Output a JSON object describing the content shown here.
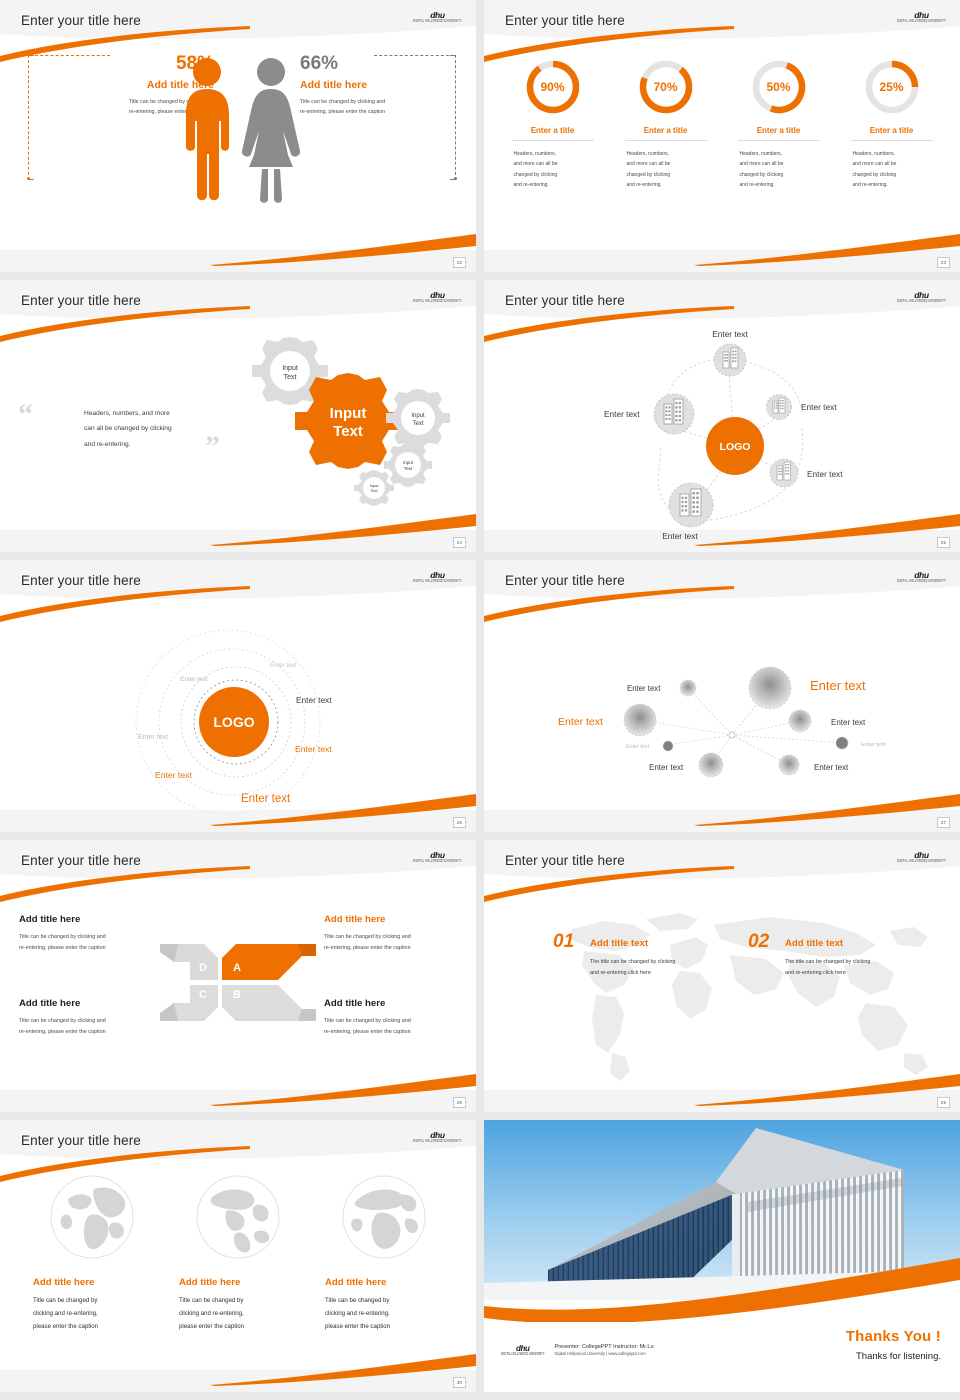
{
  "brand": {
    "accent": "#EE7000",
    "grey": "#8c8c8c",
    "logo_main": "dhu",
    "logo_sub": "DIGITAL HOLLYWOOD UNIVERSITY"
  },
  "common": {
    "title": "Enter your title here"
  },
  "slides": [
    {
      "page": "22",
      "title": "Enter your title here",
      "left": {
        "percent": "58%",
        "heading": "Add title here",
        "caption_l1": "Title can be changed by clicking and",
        "caption_l2": "re-entering, please enter the caption"
      },
      "right": {
        "percent": "66%",
        "heading": "Add title here",
        "caption_l1": "Title can be changed by clicking and",
        "caption_l2": "re-entering, please enter the caption"
      },
      "icons": [
        "male-figure-icon",
        "female-figure-icon"
      ]
    },
    {
      "page": "23",
      "title": "Enter your title here",
      "rings": [
        {
          "value": "90%",
          "pct": 90,
          "title": "Enter a title",
          "body_l1": "Headers, numbers,",
          "body_l2": "and more can all be",
          "body_l3": "changed by clicking",
          "body_l4": "and re-entering."
        },
        {
          "value": "70%",
          "pct": 70,
          "title": "Enter a title",
          "body_l1": "Headers, numbers,",
          "body_l2": "and more can all be",
          "body_l3": "changed by clicking",
          "body_l4": "and re-entering."
        },
        {
          "value": "50%",
          "pct": 50,
          "title": "Enter a title",
          "body_l1": "Headers, numbers,",
          "body_l2": "and more can all be",
          "body_l3": "changed by clicking",
          "body_l4": "and re-entering."
        },
        {
          "value": "25%",
          "pct": 25,
          "title": "Enter a title",
          "body_l1": "Headers, numbers,",
          "body_l2": "and more can all be",
          "body_l3": "changed by clicking",
          "body_l4": "and re-entering."
        }
      ]
    },
    {
      "page": "24",
      "title": "Enter your title here",
      "quote_l1": "Headers, numbers, and more",
      "quote_l2": "can all be changed by clicking",
      "quote_l3": "and re-entering.",
      "gears": [
        {
          "label_l1": "Input",
          "label_l2": "Text",
          "color": "grey"
        },
        {
          "label_l1": "Input",
          "label_l2": "Text",
          "color": "orange"
        },
        {
          "label_l1": "Input",
          "label_l2": "Text",
          "color": "grey"
        },
        {
          "label_l1": "Input",
          "label_l2": "Text",
          "color": "grey"
        },
        {
          "label_l1": "Input",
          "label_l2": "Text",
          "color": "grey"
        }
      ]
    },
    {
      "page": "25",
      "title": "Enter your title here",
      "hub_label": "LOGO",
      "nodes": [
        {
          "label": "Enter text"
        },
        {
          "label": "Enter text"
        },
        {
          "label": "Enter text"
        },
        {
          "label": "Enter text"
        },
        {
          "label": "Enter text"
        }
      ]
    },
    {
      "page": "26",
      "title": "Enter your title here",
      "hub_label": "LOGO",
      "orbit_labels": [
        "Enter text",
        "Enter text",
        "Enter text",
        "Enter text",
        "Enter text",
        "Enter text"
      ]
    },
    {
      "page": "27",
      "title": "Enter your title here",
      "nodes": [
        {
          "label": "Enter text"
        },
        {
          "label": "Enter text"
        },
        {
          "label": "Enter text"
        },
        {
          "label": "Enter text"
        },
        {
          "label": "Enter text"
        },
        {
          "label": "Enter text"
        },
        {
          "label": "Enter text"
        },
        {
          "label": "Enter text"
        }
      ]
    },
    {
      "page": "28",
      "title": "Enter your title here",
      "quads": [
        {
          "heading": "Add title here",
          "accent": false,
          "p1": "Title can be changed by clicking and",
          "p2": "re-entering, please enter the caption"
        },
        {
          "heading": "Add title here",
          "accent": true,
          "p1": "Title can be changed by clicking and",
          "p2": "re-entering, please enter the caption"
        },
        {
          "heading": "Add title here",
          "accent": false,
          "p1": "Title can be changed by clicking and",
          "p2": "re-entering, please enter the caption"
        },
        {
          "heading": "Add title here",
          "accent": false,
          "p1": "Title can be changed by clicking and",
          "p2": "re-entering, please enter the caption"
        }
      ],
      "letters": [
        "A",
        "B",
        "C",
        "D"
      ]
    },
    {
      "page": "29",
      "title": "Enter your title here",
      "items": [
        {
          "num": "01",
          "heading": "Add title text",
          "p1": "The title can be changed by clicking",
          "p2": "and re-entering click here"
        },
        {
          "num": "02",
          "heading": "Add title text",
          "p1": "The title can be changed by clicking",
          "p2": "and re-entering click here"
        }
      ]
    },
    {
      "page": "30",
      "title": "Enter your title here",
      "cards": [
        {
          "heading": "Add title here",
          "p1": "Title can be changed by",
          "p2": "clicking and re-entering,",
          "p3": "please enter the caption"
        },
        {
          "heading": "Add title here",
          "p1": "Title can be changed by",
          "p2": "clicking and re-entering,",
          "p3": "please enter the caption"
        },
        {
          "heading": "Add title here",
          "p1": "Title can be changed by",
          "p2": "clicking and re-entering,",
          "p3": "please enter the caption"
        }
      ]
    },
    {
      "page": "",
      "thanks_title": "Thanks You !",
      "thanks_sub": "Thanks for listening.",
      "presenter_line": "Presenter: CollegePPT   Instructor: Mr.Lu",
      "org_line": "Digital Hollywood University  |  www.collegeppt.com",
      "logo_main": "dhu",
      "logo_sub": "DIGITAL HOLLYWOOD UNIVERSITY"
    }
  ]
}
